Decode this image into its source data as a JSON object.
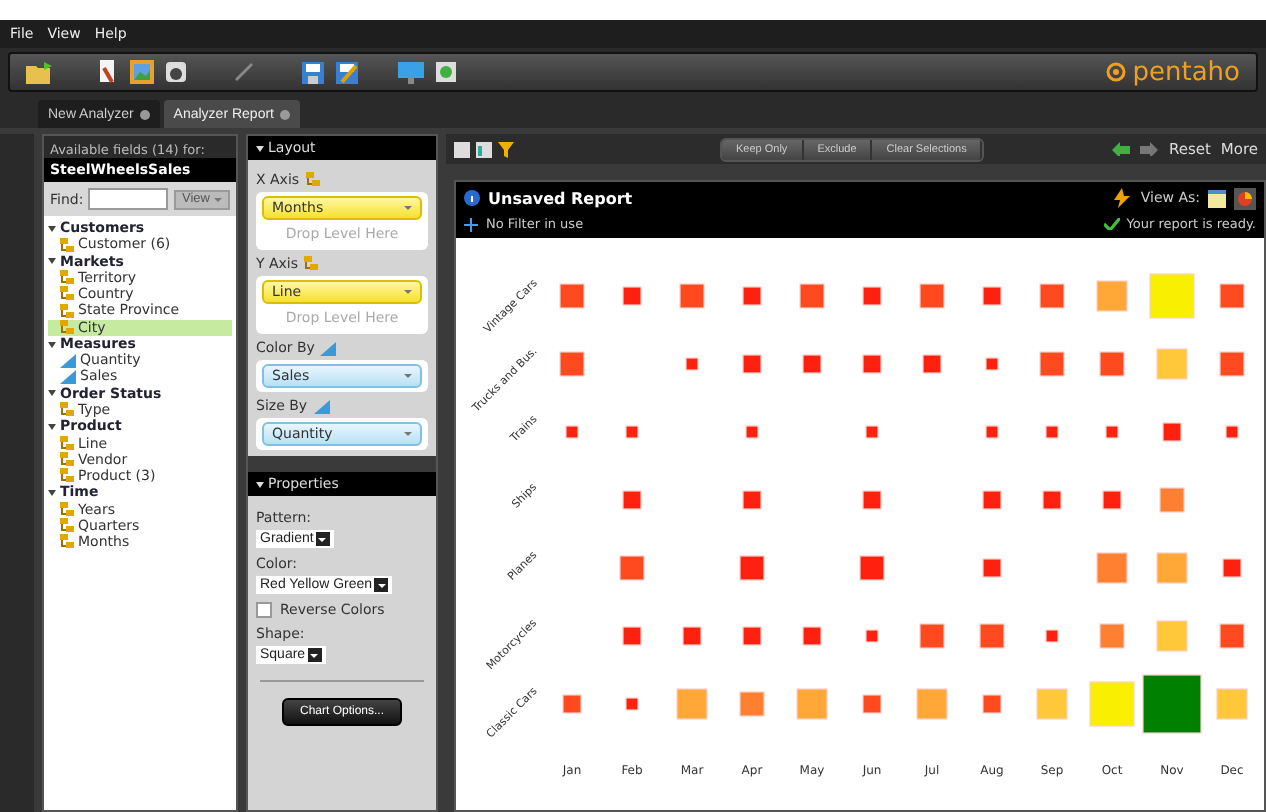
{
  "menu": [
    "File",
    "View",
    "Help"
  ],
  "logo": "pentaho",
  "tabs": [
    {
      "label": "New Analyzer",
      "selected": false
    },
    {
      "label": "Analyzer Report",
      "selected": true
    }
  ],
  "fields_panel": {
    "header": "Available fields (14) for:",
    "model": "SteelWheelsSales",
    "find_label": "Find:",
    "view_button": "View",
    "groups": [
      {
        "label": "Customers",
        "children": [
          {
            "label": "Customer (6)",
            "kind": "level",
            "selected": false
          }
        ]
      },
      {
        "label": "Markets",
        "children": [
          {
            "label": "Territory",
            "kind": "level",
            "selected": false
          },
          {
            "label": "Country",
            "kind": "level",
            "selected": false
          },
          {
            "label": "State Province",
            "kind": "level",
            "selected": false
          },
          {
            "label": "City",
            "kind": "level",
            "selected": true
          }
        ]
      },
      {
        "label": "Measures",
        "children": [
          {
            "label": "Quantity",
            "kind": "measure",
            "selected": false
          },
          {
            "label": "Sales",
            "kind": "measure",
            "selected": false
          }
        ]
      },
      {
        "label": "Order Status",
        "children": [
          {
            "label": "Type",
            "kind": "level",
            "selected": false
          }
        ]
      },
      {
        "label": "Product",
        "children": [
          {
            "label": "Line",
            "kind": "level",
            "selected": false
          },
          {
            "label": "Vendor",
            "kind": "level",
            "selected": false
          },
          {
            "label": "Product (3)",
            "kind": "level",
            "selected": false
          }
        ]
      },
      {
        "label": "Time",
        "children": [
          {
            "label": "Years",
            "kind": "level",
            "selected": false
          },
          {
            "label": "Quarters",
            "kind": "level",
            "selected": false
          },
          {
            "label": "Months",
            "kind": "level",
            "selected": false
          }
        ]
      }
    ]
  },
  "layout_panel": {
    "title": "Layout",
    "sections": [
      {
        "label": "X Axis",
        "kind": "level",
        "field": "Months",
        "drop_hint": "Drop Level Here"
      },
      {
        "label": "Y Axis",
        "kind": "level",
        "field": "Line",
        "drop_hint": "Drop Level Here"
      },
      {
        "label": "Color By",
        "kind": "measure",
        "field": "Sales"
      },
      {
        "label": "Size By",
        "kind": "measure",
        "field": "Quantity"
      }
    ]
  },
  "properties_panel": {
    "title": "Properties",
    "pattern_label": "Pattern:",
    "pattern": "Gradient",
    "color_label": "Color:",
    "color_scheme": "Red Yellow Green",
    "reverse_colors": {
      "label": "Reverse Colors",
      "checked": false
    },
    "shape_label": "Shape:",
    "shape": "Square",
    "chart_options": "Chart Options..."
  },
  "report": {
    "actions": [
      "Keep Only",
      "Exclude",
      "Clear Selections"
    ],
    "reset": "Reset",
    "more": "More",
    "title": "Unsaved Report",
    "view_as": "View As:",
    "filter": "No Filter in use",
    "status": "Your report is ready.",
    "chart": {
      "rows": [
        "Vintage Cars",
        "Trucks and Bus.",
        "Trains",
        "Ships",
        "Planes",
        "Motorcycles",
        "Classic Cars"
      ],
      "columns": [
        "Jan",
        "Feb",
        "Mar",
        "Apr",
        "May",
        "Jun",
        "Jul",
        "Aug",
        "Sep",
        "Oct",
        "Nov",
        "Dec"
      ]
    }
  }
}
